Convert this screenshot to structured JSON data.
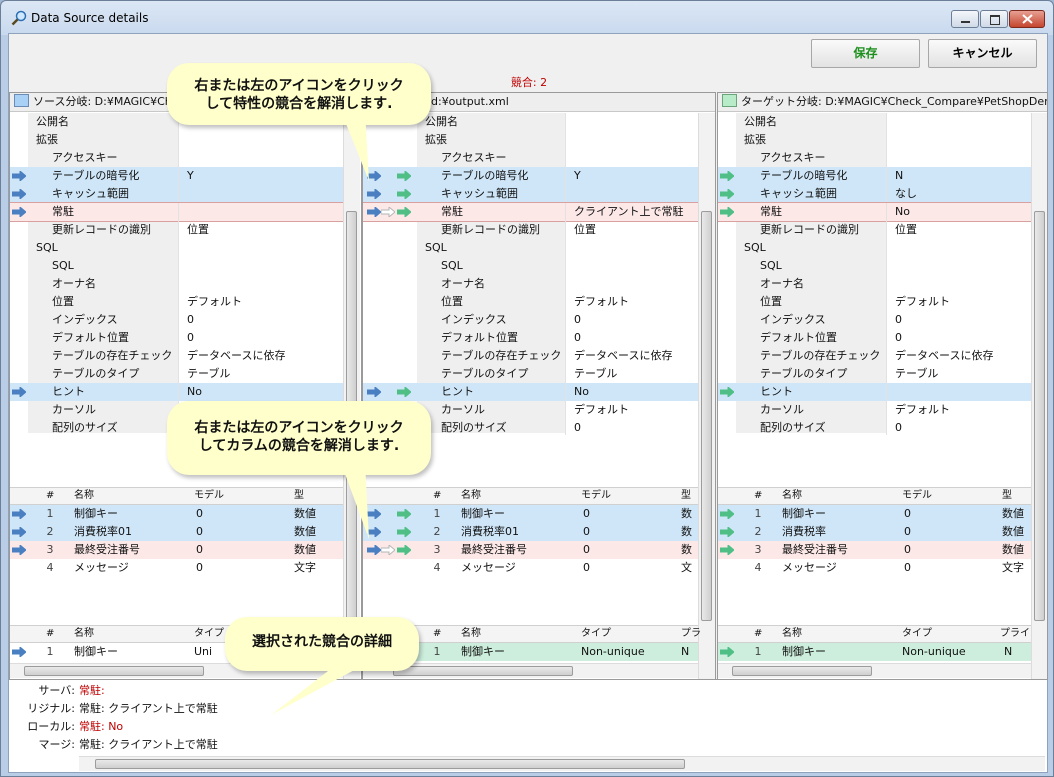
{
  "window": {
    "title": "Data Source details"
  },
  "toolbar": {
    "save_label": "保存",
    "cancel_label": "キャンセル",
    "conflict_count": "競合: 2"
  },
  "colors": {
    "blue_row": "#cfe6f8",
    "pink_row": "#fde8e8",
    "green_row": "#cdeedd",
    "save_text": "#1c8f1c",
    "conflict_red": "#c00000"
  },
  "panes": [
    {
      "id": "source",
      "header": "ソース分岐: D:¥MAGIC¥Che",
      "header_color": "#a9d0f5"
    },
    {
      "id": "merge",
      "header": "d:¥output.xml",
      "header_color": "#ffffff"
    },
    {
      "id": "target",
      "header": "ターゲット分岐: D:¥MAGIC¥Check_Compare¥PetShopDemo_Bas",
      "header_color": "#b8ecc8"
    }
  ],
  "properties": [
    {
      "name": "公開名",
      "indent": 1,
      "src": "",
      "mrg": "",
      "tgt": "",
      "state": ""
    },
    {
      "name": "拡張",
      "indent": 1,
      "src": "",
      "mrg": "",
      "tgt": "",
      "state": ""
    },
    {
      "name": "アクセスキー",
      "indent": 2,
      "src": "",
      "mrg": "",
      "tgt": "",
      "state": ""
    },
    {
      "name": "テーブルの暗号化",
      "indent": 2,
      "src": "Y",
      "mrg": "Y",
      "tgt": "N",
      "state": "blue"
    },
    {
      "name": "キャッシュ範囲",
      "indent": 2,
      "src": "",
      "mrg": "",
      "tgt": "なし",
      "state": "blue"
    },
    {
      "name": "常駐",
      "indent": 2,
      "src": "",
      "mrg": "クライアント上で常駐",
      "tgt": "No",
      "state": "pink"
    },
    {
      "name": "更新レコードの識別",
      "indent": 2,
      "src": "位置",
      "mrg": "位置",
      "tgt": "位置",
      "state": ""
    },
    {
      "name": "SQL",
      "indent": 1,
      "src": "",
      "mrg": "",
      "tgt": "",
      "state": ""
    },
    {
      "name": "SQL",
      "indent": 2,
      "src": "",
      "mrg": "",
      "tgt": "",
      "state": ""
    },
    {
      "name": "オーナ名",
      "indent": 2,
      "src": "",
      "mrg": "",
      "tgt": "",
      "state": ""
    },
    {
      "name": "位置",
      "indent": 2,
      "src": "デフォルト",
      "mrg": "デフォルト",
      "tgt": "デフォルト",
      "state": ""
    },
    {
      "name": "インデックス",
      "indent": 2,
      "src": "0",
      "mrg": "0",
      "tgt": "0",
      "state": ""
    },
    {
      "name": "デフォルト位置",
      "indent": 2,
      "src": "0",
      "mrg": "0",
      "tgt": "0",
      "state": ""
    },
    {
      "name": "テーブルの存在チェック",
      "indent": 2,
      "src": "データベースに依存",
      "mrg": "データベースに依存",
      "tgt": "データベースに依存",
      "state": ""
    },
    {
      "name": "テーブルのタイプ",
      "indent": 2,
      "src": "テーブル",
      "mrg": "テーブル",
      "tgt": "テーブル",
      "state": ""
    },
    {
      "name": "ヒント",
      "indent": 2,
      "src": "No",
      "mrg": "No",
      "tgt": "",
      "state": "blue"
    },
    {
      "name": "カーソル",
      "indent": 2,
      "src": "",
      "mrg": "デフォルト",
      "tgt": "デフォルト",
      "state": ""
    },
    {
      "name": "配列のサイズ",
      "indent": 2,
      "src": "",
      "mrg": "0",
      "tgt": "0",
      "state": ""
    }
  ],
  "columns_table": {
    "headers": {
      "num": "#",
      "name": "名称",
      "model": "モデル",
      "type": "型"
    },
    "rows": [
      {
        "num": "1",
        "src_name": "制御キー",
        "mrg_name": "制御キー",
        "tgt_name": "制御キー",
        "model": "0",
        "type": "数値",
        "src_type": "数値",
        "mrg_type": "数",
        "state": "blue"
      },
      {
        "num": "2",
        "src_name": "消費税率01",
        "mrg_name": "消費税率01",
        "tgt_name": "消費税率",
        "model": "0",
        "type": "数値",
        "src_type": "数値",
        "mrg_type": "数",
        "state": "blue"
      },
      {
        "num": "3",
        "src_name": "最終受注番号",
        "mrg_name": "最終受注番号",
        "tgt_name": "最終受注番号",
        "model": "0",
        "type": "数値",
        "src_type": "数値",
        "mrg_type": "数",
        "state": "pink"
      },
      {
        "num": "4",
        "src_name": "メッセージ",
        "mrg_name": "メッセージ",
        "tgt_name": "メッセージ",
        "model": "0",
        "type": "文字",
        "src_type": "文字",
        "mrg_type": "文",
        "state": ""
      }
    ]
  },
  "index_table": {
    "headers": {
      "num": "#",
      "name": "名称",
      "type": "タイプ",
      "primary": "プライ",
      "primary_short": "プラ"
    },
    "rows": [
      {
        "num": "1",
        "name": "制御キー",
        "src_type": "Uni",
        "type": "Non-unique",
        "primary": "N"
      }
    ]
  },
  "details": {
    "rows": [
      {
        "label": "サーバ:",
        "value": "常駐:",
        "red": true
      },
      {
        "label": "リジナル:",
        "value": "常駐: クライアント上で常駐",
        "red": false
      },
      {
        "label": "ローカル:",
        "value": "常駐: No",
        "red": true
      },
      {
        "label": "マージ:",
        "value": "常駐: クライアント上で常駐",
        "red": false
      }
    ]
  },
  "callouts": [
    {
      "text_line1": "右または左のアイコンをクリック",
      "text_line2": "して特性の競合を解消します."
    },
    {
      "text_line1": "右または左のアイコンをクリック",
      "text_line2": "してカラムの競合を解消します."
    },
    {
      "text_line1": "選択された競合の詳細"
    }
  ]
}
